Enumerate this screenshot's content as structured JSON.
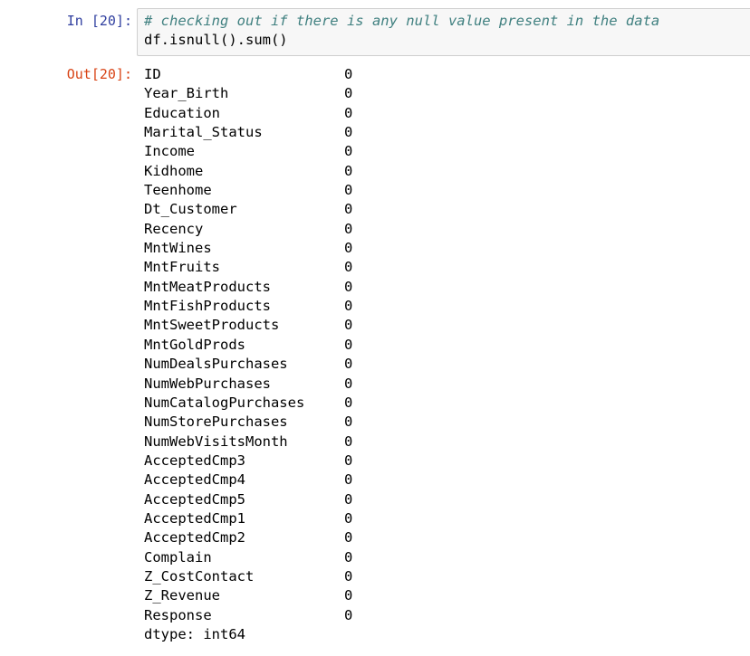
{
  "cell": {
    "in_prompt": "In [20]:",
    "out_prompt": "Out[20]:",
    "code_comment": "# checking out if there is any null value present in the data",
    "code_expr": "df.isnull().sum()",
    "output": {
      "rows": [
        {
          "name": "ID",
          "value": "0"
        },
        {
          "name": "Year_Birth",
          "value": "0"
        },
        {
          "name": "Education",
          "value": "0"
        },
        {
          "name": "Marital_Status",
          "value": "0"
        },
        {
          "name": "Income",
          "value": "0"
        },
        {
          "name": "Kidhome",
          "value": "0"
        },
        {
          "name": "Teenhome",
          "value": "0"
        },
        {
          "name": "Dt_Customer",
          "value": "0"
        },
        {
          "name": "Recency",
          "value": "0"
        },
        {
          "name": "MntWines",
          "value": "0"
        },
        {
          "name": "MntFruits",
          "value": "0"
        },
        {
          "name": "MntMeatProducts",
          "value": "0"
        },
        {
          "name": "MntFishProducts",
          "value": "0"
        },
        {
          "name": "MntSweetProducts",
          "value": "0"
        },
        {
          "name": "MntGoldProds",
          "value": "0"
        },
        {
          "name": "NumDealsPurchases",
          "value": "0"
        },
        {
          "name": "NumWebPurchases",
          "value": "0"
        },
        {
          "name": "NumCatalogPurchases",
          "value": "0"
        },
        {
          "name": "NumStorePurchases",
          "value": "0"
        },
        {
          "name": "NumWebVisitsMonth",
          "value": "0"
        },
        {
          "name": "AcceptedCmp3",
          "value": "0"
        },
        {
          "name": "AcceptedCmp4",
          "value": "0"
        },
        {
          "name": "AcceptedCmp5",
          "value": "0"
        },
        {
          "name": "AcceptedCmp1",
          "value": "0"
        },
        {
          "name": "AcceptedCmp2",
          "value": "0"
        },
        {
          "name": "Complain",
          "value": "0"
        },
        {
          "name": "Z_CostContact",
          "value": "0"
        },
        {
          "name": "Z_Revenue",
          "value": "0"
        },
        {
          "name": "Response",
          "value": "0"
        }
      ],
      "dtype": "dtype: int64"
    }
  },
  "colors": {
    "in_prompt": "#303F9F",
    "out_prompt": "#D84315",
    "comment": "#408080",
    "input_bg": "#f7f7f7",
    "input_border": "#cfcfcf"
  }
}
